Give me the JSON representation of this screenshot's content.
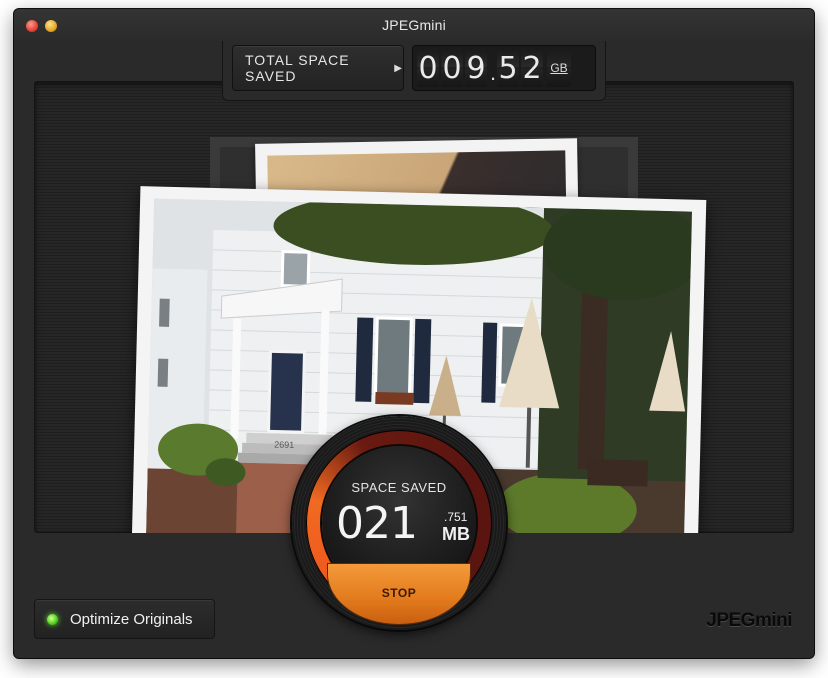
{
  "window": {
    "title": "JPEGmini"
  },
  "counter": {
    "label": "TOTAL SPACE SAVED",
    "digits": [
      "0",
      "0",
      "9",
      "5",
      "2"
    ],
    "decimal_point": ".",
    "unit": "GB"
  },
  "gauge": {
    "label": "SPACE SAVED",
    "value": "021",
    "decimal": ".751",
    "unit": "MB",
    "stop_label": "STOP",
    "ring_color": "#f05a1e"
  },
  "photo": {
    "house_number": "2691"
  },
  "footer": {
    "optimize_label": "Optimize Originals",
    "led_color": "#56d323",
    "brand": "JPEGmini"
  }
}
